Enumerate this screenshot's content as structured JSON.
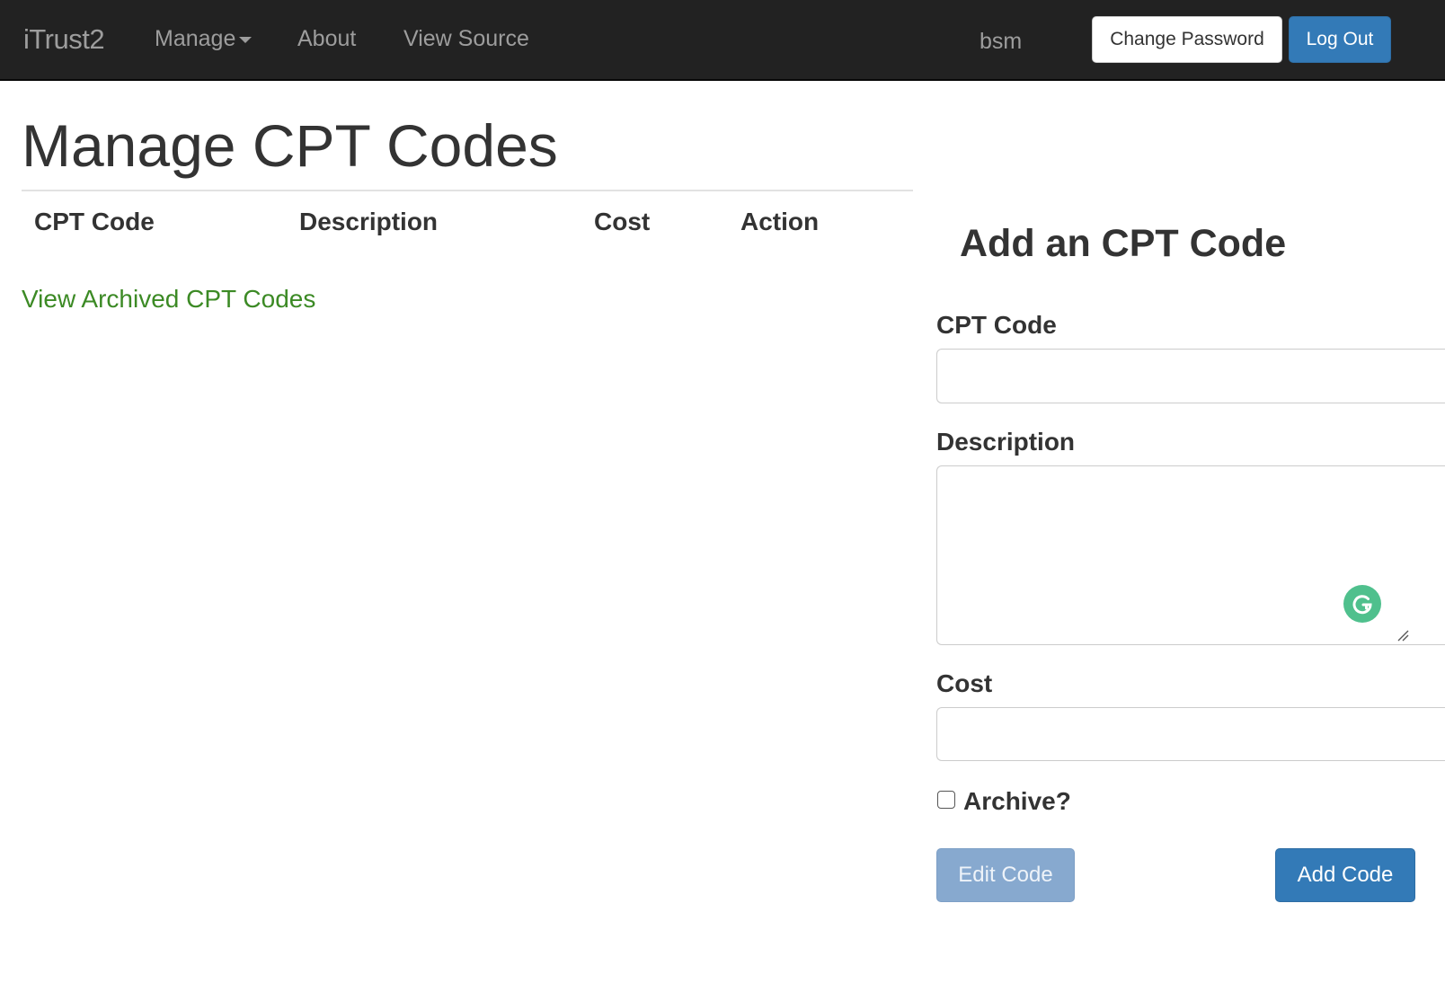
{
  "navbar": {
    "brand": "iTrust2",
    "links": [
      "Manage",
      "About",
      "View Source"
    ],
    "user": "bsm",
    "change_password": "Change Password",
    "log_out": "Log Out"
  },
  "page": {
    "title": "Manage CPT Codes",
    "table_headers": [
      "CPT Code",
      "Description",
      "Cost",
      "Action"
    ],
    "archived_link": "View Archived CPT Codes"
  },
  "form": {
    "title": "Add an CPT Code",
    "code_label": "CPT Code",
    "code_value": "",
    "description_label": "Description",
    "description_value": "",
    "cost_label": "Cost",
    "cost_value": "",
    "archive_label": "Archive?",
    "archive_checked": false,
    "edit_button": "Edit Code",
    "add_button": "Add Code"
  },
  "colors": {
    "navbar_bg": "#222222",
    "primary": "#337ab7",
    "link_green": "#3c8a25",
    "grammarly_green": "#4fc08d"
  }
}
